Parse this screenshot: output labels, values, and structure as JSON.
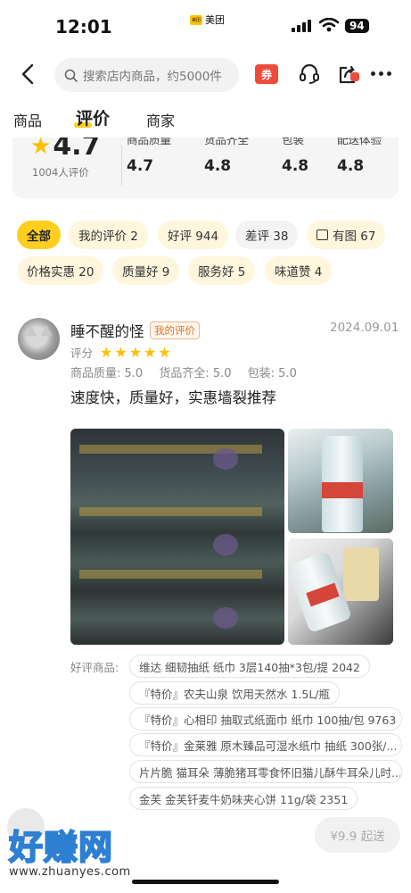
{
  "status_bar": {
    "time": "12:01",
    "app_label": "美团",
    "app_badge": "美团",
    "battery": "94"
  },
  "nav": {
    "search_placeholder": "搜索店内商品，约5000件",
    "coupon_label": "券"
  },
  "tabs": [
    {
      "label": "商品"
    },
    {
      "label": "评价"
    },
    {
      "label": "商家"
    }
  ],
  "rating": {
    "overall": "4.7",
    "review_count": "1004人评价",
    "metrics": [
      {
        "label": "商品质量",
        "value": "4.7"
      },
      {
        "label": "货品齐全",
        "value": "4.8"
      },
      {
        "label": "包装",
        "value": "4.8"
      },
      {
        "label": "配送体验",
        "value": "4.8"
      }
    ]
  },
  "filters": [
    {
      "label": "全部"
    },
    {
      "label": "我的评价 2"
    },
    {
      "label": "好评 944"
    },
    {
      "label": "差评 38"
    },
    {
      "label": "有图 67"
    },
    {
      "label": "价格实惠 20"
    },
    {
      "label": "质量好 9"
    },
    {
      "label": "服务好 5"
    },
    {
      "label": "味道赞 4"
    }
  ],
  "review": {
    "name": "睡不醒的怪",
    "badge": "我的评价",
    "date": "2024.09.01",
    "rating_label": "评分",
    "stars": 5,
    "sub_scores": [
      "商品质量: 5.0",
      "货品齐全: 5.0",
      "包装: 5.0"
    ],
    "text": "速度快，质量好，实惠墙裂推荐",
    "goods_label": "好评商品:",
    "goods": [
      "维达 细韧抽纸 纸巾 3层140抽*3包/提 2042",
      "『特价』农夫山泉 饮用天然水 1.5L/瓶",
      "『特价』心相印 抽取式纸面巾 纸巾 100抽/包 9763",
      "『特价』金莱雅 原木臻品可湿水纸巾 抽纸 300张/...",
      "片片脆 猫耳朵 薄脆猪耳零食怀旧猫儿酥牛耳朵儿时...",
      "金芙 金芙钎麦牛奶味夹心饼 11g/袋 2351"
    ]
  },
  "footer": {
    "min_order": "¥9.9 起送",
    "watermark_title": "好赚网",
    "watermark_url": "www.zhuanyes.com"
  }
}
